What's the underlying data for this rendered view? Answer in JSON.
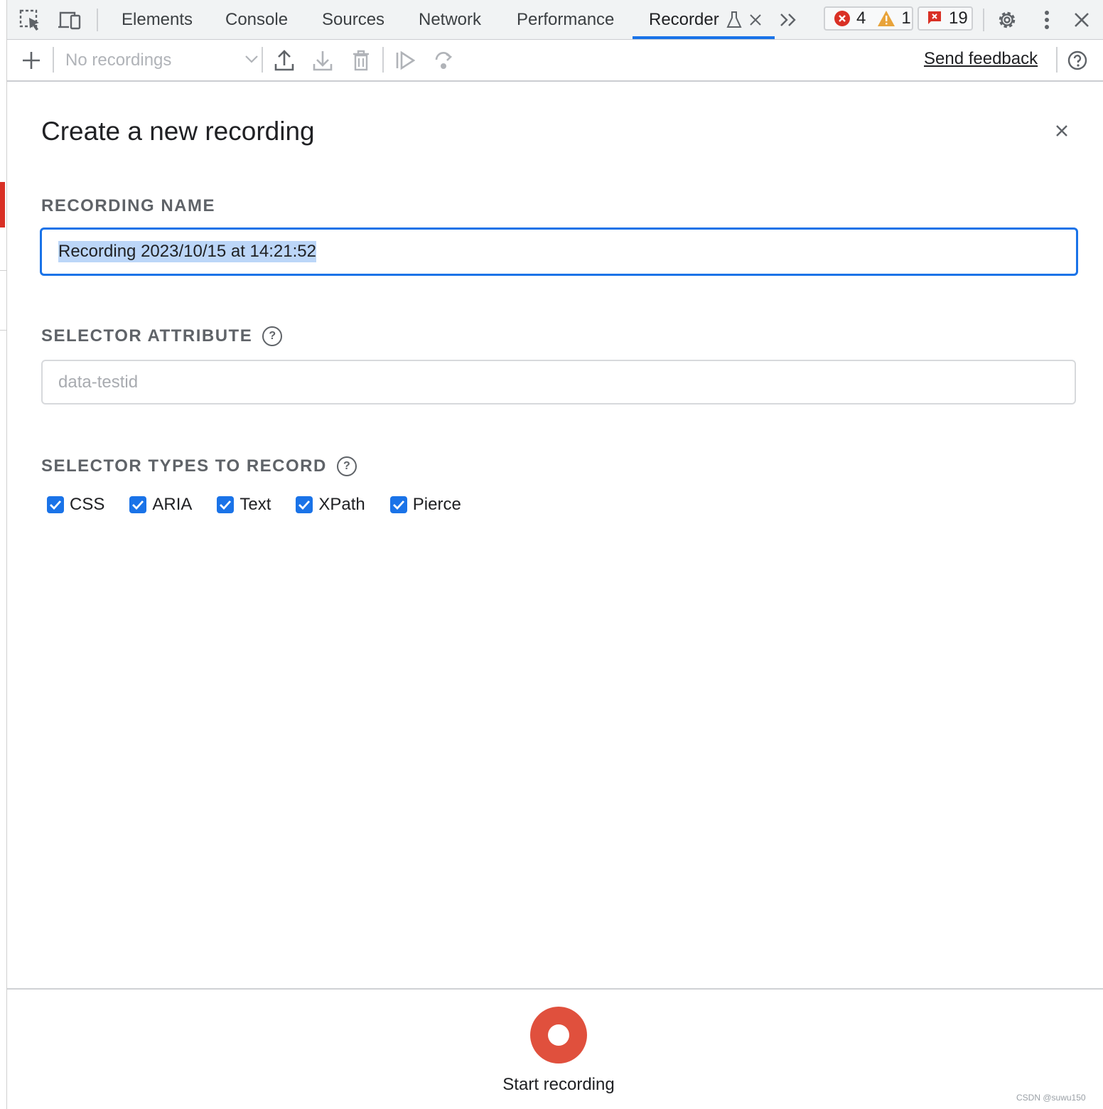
{
  "tabs": [
    {
      "label": "Elements"
    },
    {
      "label": "Console"
    },
    {
      "label": "Sources"
    },
    {
      "label": "Network"
    },
    {
      "label": "Performance"
    },
    {
      "label": "Recorder",
      "active": true
    }
  ],
  "counters": {
    "errors": "4",
    "warnings": "1",
    "issues": "19"
  },
  "toolbar": {
    "recordings_select": "No recordings",
    "send_feedback": "Send feedback"
  },
  "dialog": {
    "title": "Create a new recording",
    "recording_name_label": "RECORDING NAME",
    "recording_name_value": "Recording 2023/10/15 at 14:21:52",
    "selector_attribute_label": "SELECTOR ATTRIBUTE",
    "selector_attribute_placeholder": "data-testid",
    "selector_types_label": "SELECTOR TYPES TO RECORD",
    "selector_types": [
      {
        "label": "CSS",
        "checked": true
      },
      {
        "label": "ARIA",
        "checked": true
      },
      {
        "label": "Text",
        "checked": true
      },
      {
        "label": "XPath",
        "checked": true
      },
      {
        "label": "Pierce",
        "checked": true
      }
    ],
    "start_recording": "Start recording"
  },
  "watermark": "CSDN @suwu150",
  "colors": {
    "accent": "#1a73e8",
    "record": "#e0503d",
    "error": "#d93025",
    "warning": "#e8a33a"
  }
}
